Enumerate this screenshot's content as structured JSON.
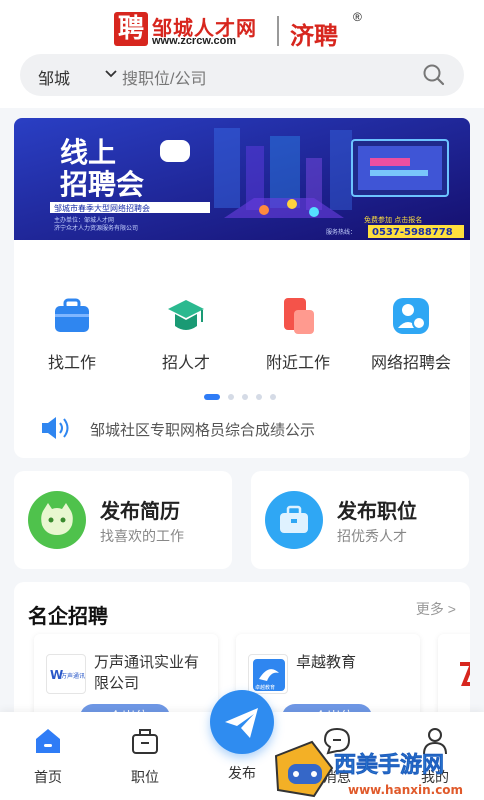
{
  "header": {
    "logo_mark": "聘",
    "logo_name": "邹城人才网",
    "logo_url": "www.zcrcw.com",
    "logo_brand": "济聘",
    "logo_reg": "®"
  },
  "search": {
    "city": "邹城",
    "placeholder": "搜职位/公司"
  },
  "banner": {
    "title_line1": "线上",
    "title_line2": "招聘会",
    "subtitle": "邹城市春季大型网络招聘会",
    "organizer1": "主办单位：邹城人才网",
    "organizer2": "济宁众才人力资源服务有限公司",
    "cta": "免费参加 点击报名",
    "phone_label": "服务热线：",
    "phone": "0537-5988778"
  },
  "quick_links": [
    {
      "label": "找工作",
      "icon": "briefcase-icon"
    },
    {
      "label": "招人才",
      "icon": "graduation-cap-icon"
    },
    {
      "label": "附近工作",
      "icon": "location-card-icon"
    },
    {
      "label": "网络招聘会",
      "icon": "online-fair-icon"
    }
  ],
  "carousel": {
    "count": 5,
    "active": 0
  },
  "notice": {
    "text": "邹城社区专职网格员综合成绩公示"
  },
  "actions": [
    {
      "title": "发布简历",
      "subtitle": "找喜欢的工作",
      "icon": "resume-face-icon"
    },
    {
      "title": "发布职位",
      "subtitle": "招优秀人才",
      "icon": "job-bag-icon"
    }
  ],
  "companies": {
    "title": "名企招聘",
    "more": "更多 >",
    "items": [
      {
        "name": "万声通讯实业有限公司",
        "logo_text": "万声通讯",
        "badge": "7个岗位"
      },
      {
        "name": "卓越教育",
        "logo_text": "卓越教育",
        "badge": "11个岗位"
      }
    ]
  },
  "tabs": [
    {
      "label": "首页",
      "icon": "home-icon",
      "active": true
    },
    {
      "label": "职位",
      "icon": "job-icon"
    },
    {
      "label": "发布",
      "icon": "paper-plane-icon"
    },
    {
      "label": "消息",
      "icon": "message-icon"
    },
    {
      "label": "我的",
      "icon": "user-icon"
    }
  ],
  "watermark": {
    "text": "西美手游网",
    "sub": "www.hanxin.com"
  },
  "colors": {
    "brand_red": "#d7261e",
    "accent_blue": "#2f7cf6",
    "banner_bg": "#1a2fa8"
  }
}
